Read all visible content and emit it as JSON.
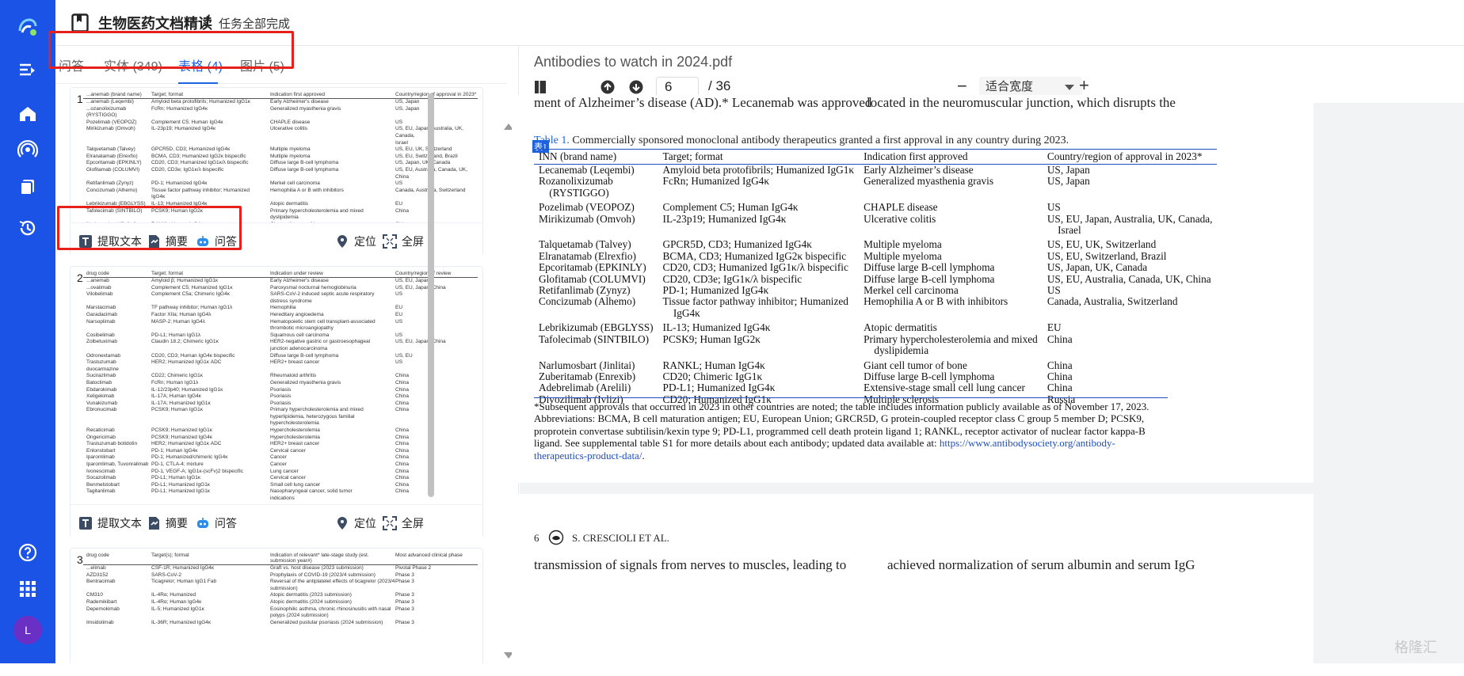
{
  "header": {
    "app_title": "生物医药文档精读",
    "separator": "/",
    "status": "任务全部完成"
  },
  "tabs": [
    {
      "label": "问答",
      "active": false
    },
    {
      "label": "实体 (349)",
      "active": false
    },
    {
      "label": "表格 (4)",
      "active": true
    },
    {
      "label": "图片 (5)",
      "active": false
    }
  ],
  "cards": [
    {
      "number": "1",
      "header": [
        "...anemab (brand name)",
        "Target; format",
        "Indication first approved",
        "Country/region of approval in 2023*"
      ],
      "rows": [
        [
          "...anemab (Leqembi)",
          "Amyloid beta protofibrils; Humanized IgG1κ",
          "Early Alzheimer's disease",
          "US, Japan"
        ],
        [
          "...ozanolixizumab",
          "FcRn; Humanized IgG4κ",
          "Generalized myasthenia gravis",
          "US, Japan"
        ],
        [
          "(RYSTIGGO)",
          "",
          "",
          ""
        ],
        [
          "Pozelimab (VEOPOZ)",
          "Complement C5; Human IgG4κ",
          "CHAPLE disease",
          "US"
        ],
        [
          "Mirikizumab (Omvoh)",
          "IL-23p19; Humanized IgG4κ",
          "Ulcerative colitis",
          "US, EU, Japan, Australia, UK, Canada,"
        ],
        [
          "",
          "",
          "",
          "Israel"
        ],
        [
          "Talquetamab (Talvey)",
          "GPCR5D, CD3; Humanized IgG4κ",
          "Multiple myeloma",
          "US, EU, UK, Switzerland"
        ],
        [
          "Elranatamab (Elrexfio)",
          "BCMA, CD3; Humanized IgG2κ bispecific",
          "Multiple myeloma",
          "US, EU, Switzerland, Brazil"
        ],
        [
          "Epcoritamab (EPKINLY)",
          "CD20, CD3; Humanized IgG1κ/λ bispecific",
          "Diffuse large B-cell lymphoma",
          "US, Japan, UK, Canada"
        ],
        [
          "Glofitamab (COLUMVI)",
          "CD20, CD3e; IgG1κ/λ bispecific",
          "Diffuse large B-cell lymphoma",
          "US, EU, Australia, Canada, UK, China"
        ],
        [
          "Retifanlimab (Zynyz)",
          "PD-1; Humanized IgG4κ",
          "Merkel cell carcinoma",
          "US"
        ],
        [
          "Concizumab (Alhemo)",
          "Tissue factor pathway inhibitor; Humanized",
          "Hemophilia A or B with inhibitors",
          "Canada, Australia, Switzerland"
        ],
        [
          "",
          "IgG4κ",
          "",
          ""
        ],
        [
          "Lebrikizumab (EBGLYSS)",
          "IL-13; Humanized IgG4κ",
          "Atopic dermatitis",
          "EU"
        ],
        [
          "Tafolecimab (SINTBILO)",
          "PCSK9; Human IgG2κ",
          "Primary hypercholesterolemia and mixed",
          "China"
        ],
        [
          "",
          "",
          "dyslipidemia",
          ""
        ],
        [
          "Narlumosbart (Jinlitai)",
          "RANKL; Human IgG4κ",
          "Giant cell tumor of bone",
          "China"
        ],
        [
          "Zuberitamab (Enrexib)",
          "CD20; Chimeric IgG1κ",
          "Diffuse large B-cell lymphoma",
          "China"
        ],
        [
          "Adebrelimab (Arelili)",
          "PD-L1; Humanized IgG4κ",
          "Extensive-stage small cell lung cancer",
          "China"
        ],
        [
          "Divozilimab (Ivlizi)",
          "CD20; Humanized IgG1κ",
          "Multiple sclerosis",
          "Russia"
        ]
      ]
    },
    {
      "number": "2",
      "header": [
        "drug code",
        "Target; format",
        "Indication under review",
        "Country/region of review"
      ],
      "rows": [
        [
          "...anemab",
          "Amyloid β; Humanized IgG1κ",
          "Early Alzheimer's disease",
          "US, EU, Japan"
        ],
        [
          "...ovalimab",
          "Complement C5; Humanized IgG1κ",
          "Paroxysmal nocturnal hemoglobinuria",
          "US, EU, Japan, China"
        ],
        [
          "Vilobelimab",
          "Complement C5a; Chimeric IgG4κ",
          "SARS-CoV-2 induced septic acute respiratory",
          "US"
        ],
        [
          "",
          "",
          "distress syndrome",
          ""
        ],
        [
          "Marstacimab",
          "TF pathway inhibitor; Human IgG1λ",
          "Hemophilia",
          "EU"
        ],
        [
          "Garadacimab",
          "Factor XIIa; Human IgG4λ",
          "Hereditary angioedema",
          "EU"
        ],
        [
          "Narsoplimab",
          "MASP-2; Human IgG4λ",
          "Hematopoietic stem cell transplant-associated",
          "US"
        ],
        [
          "",
          "",
          "thrombotic microangiopathy",
          ""
        ],
        [
          "Cosibelimab",
          "PD-L1; Human IgG1λ",
          "Squamous cell carcinoma",
          "US"
        ],
        [
          "Zolbetuximab",
          "Claudin 18.2; Chimeric IgG1κ",
          "HER2-negative gastric or gastroesophageal",
          "US, EU, Japan, China"
        ],
        [
          "",
          "",
          "junction adenocarcinoma",
          ""
        ],
        [
          "Odronextamab",
          "CD20, CD3; Human IgG4κ bispecific",
          "Diffuse large B-cell lymphoma",
          "US, EU"
        ],
        [
          "Trastuzumab",
          "HER2; Humanized IgG1κ ADC",
          "HER2+ breast cancer",
          "US"
        ],
        [
          "duocarmazine",
          "",
          "",
          ""
        ],
        [
          "Sucirazlimab",
          "CD22; Chimeric IgG1κ",
          "Rheumatoid arthritis",
          "China"
        ],
        [
          "Batoclimab",
          "FcRn; Human IgG1λ",
          "Generalized myasthenia gravis",
          "China"
        ],
        [
          "Ebdarokimab",
          "IL-12/23p40; Humanized IgG1κ",
          "Psoriasis",
          "China"
        ],
        [
          "Xeligekimab",
          "IL-17A; Human IgG4κ",
          "Psoriasis",
          "China"
        ],
        [
          "Vunakizumab",
          "IL-17A; Humanized IgG1κ",
          "Psoriasis",
          "China"
        ],
        [
          "Ebronucimab",
          "PCSK9; Human IgG1κ",
          "Primary hypercholesterolemia and mixed",
          "China"
        ],
        [
          "",
          "",
          "hyperlipidemia, heterozygous familial",
          ""
        ],
        [
          "",
          "",
          "hypercholesterolemia",
          ""
        ],
        [
          "Recaticimab",
          "PCSK9; Humanized IgG1κ",
          "Hypercholesterolemia",
          "China"
        ],
        [
          "Ongericimab",
          "PCSK9; Humanized IgG4κ",
          "Hypercholesterolemia",
          "China"
        ],
        [
          "Trastuzumab botidotin",
          "HER2; Humanized IgG1κ ADC",
          "HER2+ breast cancer",
          "China"
        ],
        [
          "Enlonstobart",
          "PD-1; Human IgG4κ",
          "Cervical cancer",
          "China"
        ],
        [
          "Iparomlimab",
          "PD-1; Humanized/chimeric IgG4κ",
          "Cancer",
          "China"
        ],
        [
          "Iparomlimab, Tuvonralimab",
          "PD-1, CTLA-4; mixture",
          "Cancer",
          "China"
        ],
        [
          "Ivonescimab",
          "PD-1, VEGF-A; IgG1κ-(scFv)2 bispecific",
          "Lung cancer",
          "China"
        ],
        [
          "Socazolimab",
          "PD-L1; Human IgG1κ",
          "Cervical cancer",
          "China"
        ],
        [
          "Benmelstobart",
          "PD-L1; Humanized IgG1κ",
          "Small cell lung cancer",
          "China"
        ],
        [
          "Tagitanlimab",
          "PD-L1; Humanized IgG1κ",
          "Nasopharyngeal cancer, solid tumor",
          "China"
        ],
        [
          "",
          "",
          "indications",
          ""
        ]
      ]
    },
    {
      "number": "3",
      "header": [
        "drug code",
        "Target(s); format",
        "Indication of relevant* late-stage study (est. submission year#)",
        "Most advanced clinical phase"
      ],
      "rows": [
        [
          "...elimab",
          "CSF-1R; Humanized IgG4κ",
          "Graft vs. host disease (2023 submission)",
          "Pivotal Phase 2"
        ],
        [
          "AZD3152",
          "SARS-CoV-2",
          "Prophylaxis of COVID-19 (2023/4 submission)",
          "Phase 3"
        ],
        [
          "Bentracimab",
          "Ticagrelor; Human IgG1 Fab",
          "Reversal of the antiplatelet effects of ticagrelor (2023/4 submission)",
          "Phase 3"
        ],
        [
          "CM310",
          "IL-4Rα; Humanized",
          "Atopic dermatitis (2023 submission)",
          "Phase 3"
        ],
        [
          "Rademikibart",
          "IL-4Rα; Human IgG4κ",
          "Atopic dermatitis (2024 submission)",
          "Phase 3"
        ],
        [
          "Depemokimab",
          "IL-5; Humanized IgG1κ",
          "Eosinophilic asthma, chronic rhinosinusitis with nasal polyps (2024 submission)",
          "Phase 3"
        ],
        [
          "Imsidolimab",
          "IL-36R; Humanized IgG4κ",
          "Generalized pustular psoriasis (2024 submission)",
          "Phase 3"
        ]
      ]
    }
  ],
  "card_actions": {
    "extract": "提取文本",
    "summary": "摘要",
    "qa": "问答",
    "locate": "定位",
    "fullscreen": "全屏"
  },
  "viewer": {
    "file_name": "Antibodies to watch in 2024.pdf",
    "current_page": "6",
    "total_pages": "/ 36",
    "zoom": "适合宽度",
    "minus": "−",
    "plus": "+"
  },
  "pdf": {
    "top_left_fragment": "ment of Alzheimer’s disease (AD).* Lecanemab was approved",
    "top_right_fragment": "located in the neuromuscular junction, which disrupts the",
    "table_tag": "表1",
    "table_title_label": "Table 1.",
    "table_title_text": " Commercially sponsored monoclonal antibody therapeutics granted a first approval in any country during 2023.",
    "table_header": [
      "INN (brand name)",
      "Target; format",
      "Indication first approved",
      "Country/region of approval in 2023*"
    ],
    "table_rows": [
      {
        "c": [
          "Lecanemab (Leqembi)",
          "Amyloid beta protofibrils; Humanized IgG1κ",
          "Early Alzheimer’s disease",
          "US, Japan"
        ],
        "gap": false
      },
      {
        "c": [
          "Rozanolixizumab",
          "FcRn; Humanized IgG4κ",
          "Generalized myasthenia gravis",
          "US, Japan"
        ],
        "gap": false
      },
      {
        "c": [
          "    (RYSTIGGO)",
          "",
          "",
          ""
        ],
        "gap": false
      },
      {
        "c": [
          "Pozelimab (VEOPOZ)",
          "Complement C5; Human IgG4κ",
          "CHAPLE disease",
          "US"
        ],
        "gap": false
      },
      {
        "c": [
          "Mirikizumab (Omvoh)",
          "IL-23p19; Humanized IgG4κ",
          "Ulcerative colitis",
          "US, EU, Japan, Australia, UK, Canada,"
        ],
        "gap": false
      },
      {
        "c": [
          "",
          "",
          "",
          "    Israel"
        ],
        "gap": false
      },
      {
        "c": [
          "Talquetamab (Talvey)",
          "GPCR5D, CD3; Humanized IgG4κ",
          "Multiple myeloma",
          "US, EU, UK, Switzerland"
        ],
        "gap": false
      },
      {
        "c": [
          "Elranatamab (Elrexfio)",
          "BCMA, CD3; Humanized IgG2κ bispecific",
          "Multiple myeloma",
          "US, EU, Switzerland, Brazil"
        ],
        "gap": false
      },
      {
        "c": [
          "Epcoritamab (EPKINLY)",
          "CD20, CD3; Humanized IgG1κ/λ bispecific",
          "Diffuse large B-cell lymphoma",
          "US, Japan, UK, Canada"
        ],
        "gap": false
      },
      {
        "c": [
          "Glofitamab (COLUMVI)",
          "CD20, CD3e; IgG1κ/λ bispecific",
          "Diffuse large B-cell lymphoma",
          "US, EU, Australia, Canada, UK, China"
        ],
        "gap": false
      },
      {
        "c": [
          "Retifanlimab (Zynyz)",
          "PD-1; Humanized IgG4κ",
          "Merkel cell carcinoma",
          "US"
        ],
        "gap": false
      },
      {
        "c": [
          "Concizumab (Alhemo)",
          "Tissue factor pathway inhibitor; Humanized",
          "Hemophilia A or B with inhibitors",
          "Canada, Australia, Switzerland"
        ],
        "gap": false
      },
      {
        "c": [
          "",
          "    IgG4κ",
          "",
          ""
        ],
        "gap": false
      },
      {
        "c": [
          "Lebrikizumab (EBGLYSS)",
          "IL-13; Humanized IgG4κ",
          "Atopic dermatitis",
          "EU"
        ],
        "gap": false
      },
      {
        "c": [
          "Tafolecimab (SINTBILO)",
          "PCSK9; Human IgG2κ",
          "Primary hypercholesterolemia and mixed",
          "China"
        ],
        "gap": false
      },
      {
        "c": [
          "",
          "",
          "    dyslipidemia",
          ""
        ],
        "gap": false
      },
      {
        "c": [
          "Narlumosbart (Jinlitai)",
          "RANKL; Human IgG4κ",
          "Giant cell tumor of bone",
          "China"
        ],
        "gap": false
      },
      {
        "c": [
          "Zuberitamab (Enrexib)",
          "CD20; Chimeric IgG1κ",
          "Diffuse large B-cell lymphoma",
          "China"
        ],
        "gap": false
      },
      {
        "c": [
          "Adebrelimab (Arelili)",
          "PD-L1; Humanized IgG4κ",
          "Extensive-stage small cell lung cancer",
          "China"
        ],
        "gap": false
      },
      {
        "c": [
          "Divozilimab (Ivlizi)",
          "CD20; Humanized IgG1κ",
          "Multiple sclerosis",
          "Russia"
        ],
        "gap": false
      }
    ],
    "footnote": "*Subsequent approvals that occurred in 2023 in other countries are noted; the table includes information publicly available as of November 17, 2023. Abbreviations: BCMA, B cell maturation antigen; EU, European Union; GRCR5D, G protein-coupled receptor class C group 5 member D; PCSK9, proprotein convertase subtilisin/kexin type 9; PD-L1, programmed cell death protein ligand 1; RANKL, receptor activator of nuclear factor kappa-B ligand. See supplemental table S1 for more details about each antibody; updated data available at: ",
    "footnote_link": "https://www.antibodysociety.org/antibody-therapeutics-product-data/",
    "footnote_end": ".",
    "page_number": "6",
    "running_head": "S. CRESCIOLI ET AL.",
    "bottom_left_fragment": "transmission of signals from nerves to muscles, leading to",
    "bottom_right_fragment": "achieved normalization of serum albumin and serum IgG"
  },
  "watermark": "格隆汇",
  "user": {
    "avatar_initial": "L"
  },
  "colors": {
    "sidebar": "#1b53e6",
    "accent": "#1d62e0",
    "highlight_box": "#e8201c",
    "avatar": "#6a2fc5"
  }
}
